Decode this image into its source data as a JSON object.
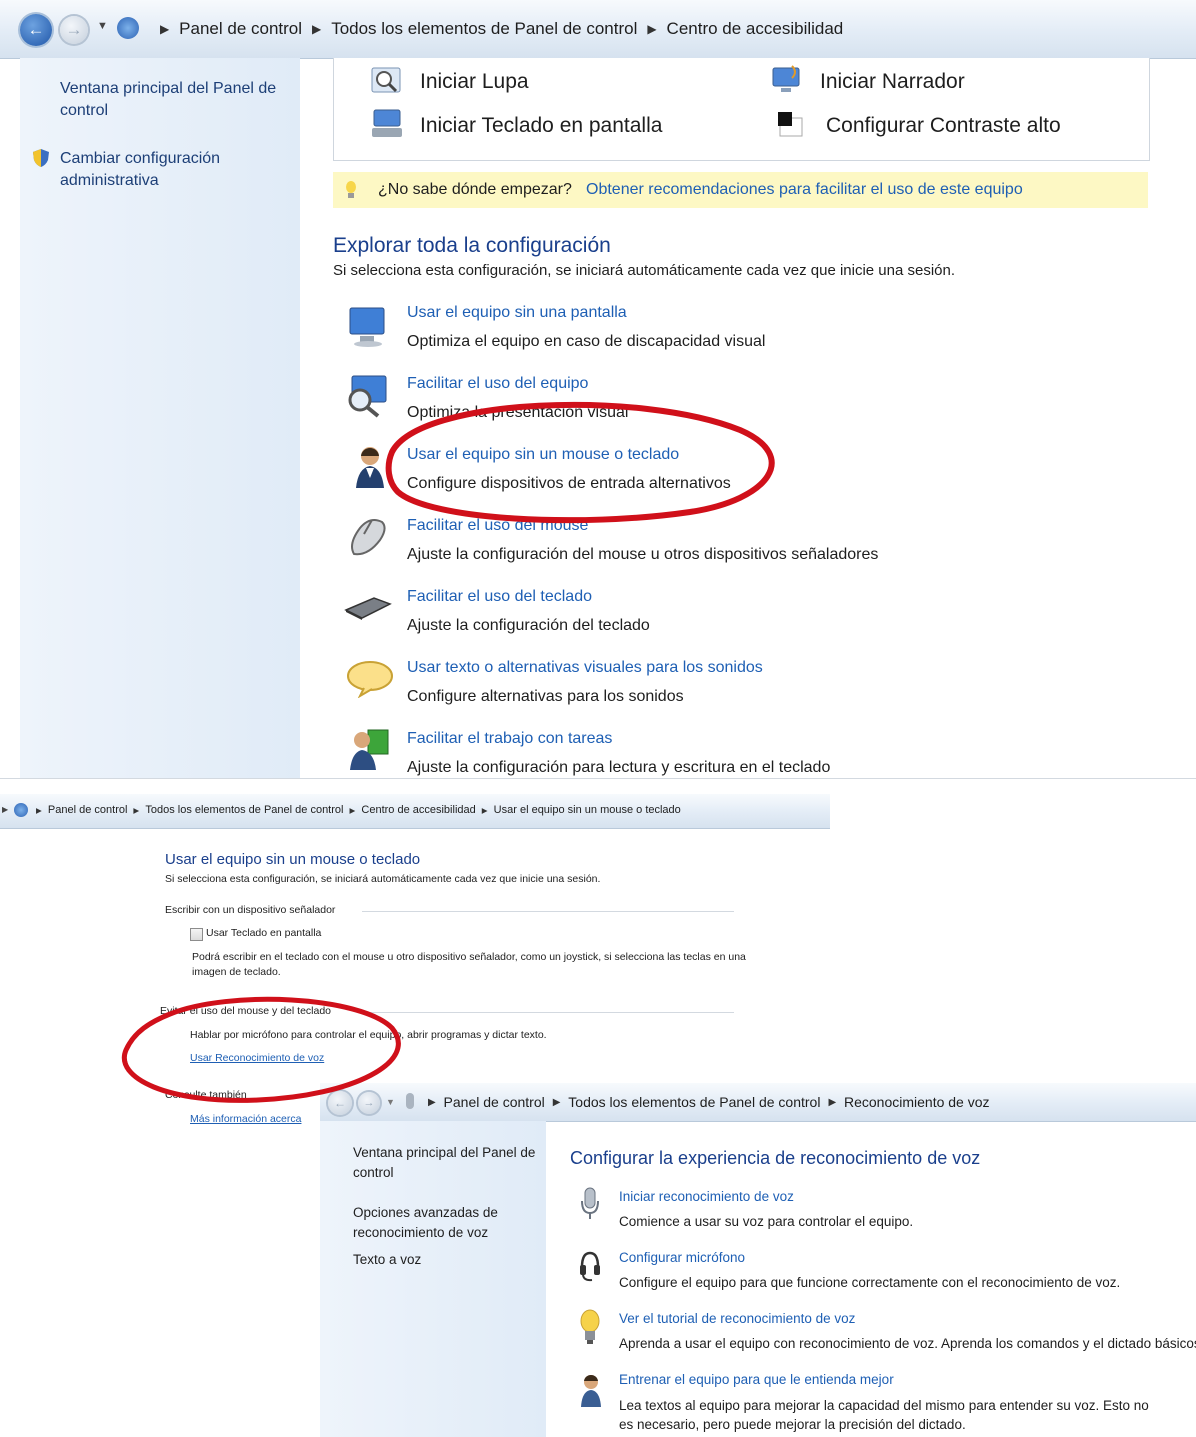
{
  "win1": {
    "breadcrumb": [
      "Panel de control",
      "Todos los elementos de Panel de control",
      "Centro de accesibilidad"
    ],
    "left_links": [
      "Ventana principal del Panel de control",
      "Cambiar configuración administrativa"
    ],
    "quick_tools": [
      "Iniciar Lupa",
      "Iniciar Narrador",
      "Iniciar Teclado en pantalla",
      "Configurar Contraste alto"
    ],
    "tip_question": "¿No sabe dónde empezar?",
    "tip_link": "Obtener recomendaciones para facilitar el uso de este equipo",
    "explore_title": "Explorar toda la configuración",
    "explore_subtitle": "Si selecciona esta configuración, se iniciará automáticamente cada vez que inicie una sesión.",
    "items": [
      {
        "title": "Usar el equipo sin una pantalla",
        "desc": "Optimiza el equipo en caso de discapacidad visual"
      },
      {
        "title": "Facilitar el uso del equipo",
        "desc": "Optimiza la presentación visual"
      },
      {
        "title": "Usar el equipo sin un mouse o teclado",
        "desc": "Configure dispositivos de entrada alternativos"
      },
      {
        "title": "Facilitar el uso del mouse",
        "desc": "Ajuste la configuración del mouse u otros dispositivos señaladores"
      },
      {
        "title": "Facilitar el uso del teclado",
        "desc": "Ajuste la configuración del teclado"
      },
      {
        "title": "Usar texto o alternativas visuales para los sonidos",
        "desc": "Configure alternativas para los sonidos"
      },
      {
        "title": "Facilitar el trabajo con tareas",
        "desc": "Ajuste la configuración para lectura y escritura en el teclado"
      }
    ]
  },
  "win2": {
    "breadcrumb": [
      "Panel de control",
      "Todos los elementos de Panel de control",
      "Centro de accesibilidad",
      "Usar el equipo sin un mouse o teclado"
    ],
    "title": "Usar el equipo sin un mouse o teclado",
    "subtitle": "Si selecciona esta configuración, se iniciará automáticamente cada vez que inicie una sesión.",
    "section1": "Escribir con un dispositivo señalador",
    "checkbox_label": "Usar Teclado en pantalla",
    "checkbox_desc": "Podrá escribir en el teclado con el mouse u otro dispositivo señalador, como un joystick, si selecciona las teclas en una imagen de teclado.",
    "section2": "Evitar el uso del mouse y del teclado",
    "speech_desc": "Hablar por micrófono para controlar el equipo, abrir programas y dictar texto.",
    "speech_link": "Usar Reconocimiento de voz",
    "section3": "Consulte también",
    "more_link": "Más información acerca"
  },
  "win3": {
    "breadcrumb": [
      "Panel de control",
      "Todos los elementos de Panel de control",
      "Reconocimiento de voz"
    ],
    "left_links": [
      "Ventana principal del Panel de control",
      "Opciones avanzadas de reconocimiento de voz",
      "Texto a voz"
    ],
    "title": "Configurar la experiencia de reconocimiento de voz",
    "items": [
      {
        "title": "Iniciar reconocimiento de voz",
        "desc": "Comience a usar su voz para controlar el equipo."
      },
      {
        "title": "Configurar micrófono",
        "desc": "Configure el equipo para que funcione correctamente con el reconocimiento de voz."
      },
      {
        "title": "Ver el tutorial de reconocimiento de voz",
        "desc": "Aprenda a usar el equipo con reconocimiento de voz. Aprenda los comandos y el dictado básicos."
      },
      {
        "title": "Entrenar el equipo para que le entienda mejor",
        "desc": "Lea textos al equipo para mejorar la capacidad del mismo para entender su voz. Esto no es necesario, pero puede mejorar la precisión del dictado."
      }
    ]
  },
  "colors": {
    "link": "#1e5fb4",
    "heading": "#1a3f8c",
    "annotation": "#d0101a",
    "tip_bg": "#fdf8c4"
  }
}
